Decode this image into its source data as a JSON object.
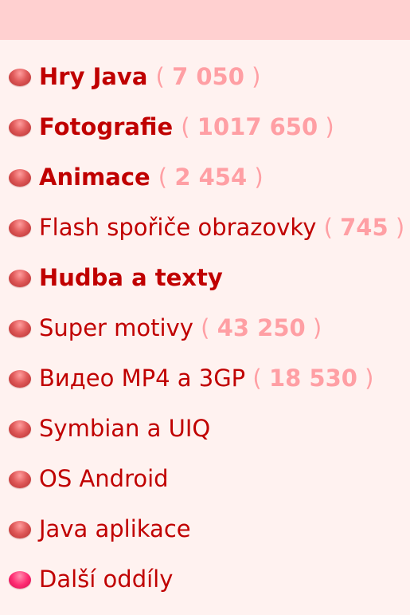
{
  "menu": {
    "items": [
      {
        "label": "Hry Java",
        "count": "7 050",
        "bold": true
      },
      {
        "label": "Fotografie",
        "count": "1017 650",
        "bold": true
      },
      {
        "label": "Animace",
        "count": "2 454",
        "bold": true
      },
      {
        "label": "Flash spořiče obrazovky",
        "count": "745",
        "bold": false
      },
      {
        "label": "Hudba a texty",
        "count": null,
        "bold": true
      },
      {
        "label": "Super motivy",
        "count": "43 250",
        "bold": false
      },
      {
        "label": "Видео MP4 a 3GP",
        "count": "18 530",
        "bold": false
      },
      {
        "label": "Symbian a UIQ",
        "count": null,
        "bold": false
      },
      {
        "label": "OS Android",
        "count": null,
        "bold": false
      },
      {
        "label": "Java aplikace",
        "count": null,
        "bold": false
      },
      {
        "label": "Další oddíly",
        "count": null,
        "bold": false
      }
    ]
  },
  "colors": {
    "header_bar": "#ffd0d0",
    "background": "#fff2f0",
    "link": "#c00000",
    "count": "#ff9fa4",
    "bullet_red": "#d84a4a",
    "bullet_pink": "#ff2e73"
  },
  "icons": {
    "bullet": "red-ball-bullet-icon",
    "last_bullet": "pink-ball-bullet-icon"
  }
}
